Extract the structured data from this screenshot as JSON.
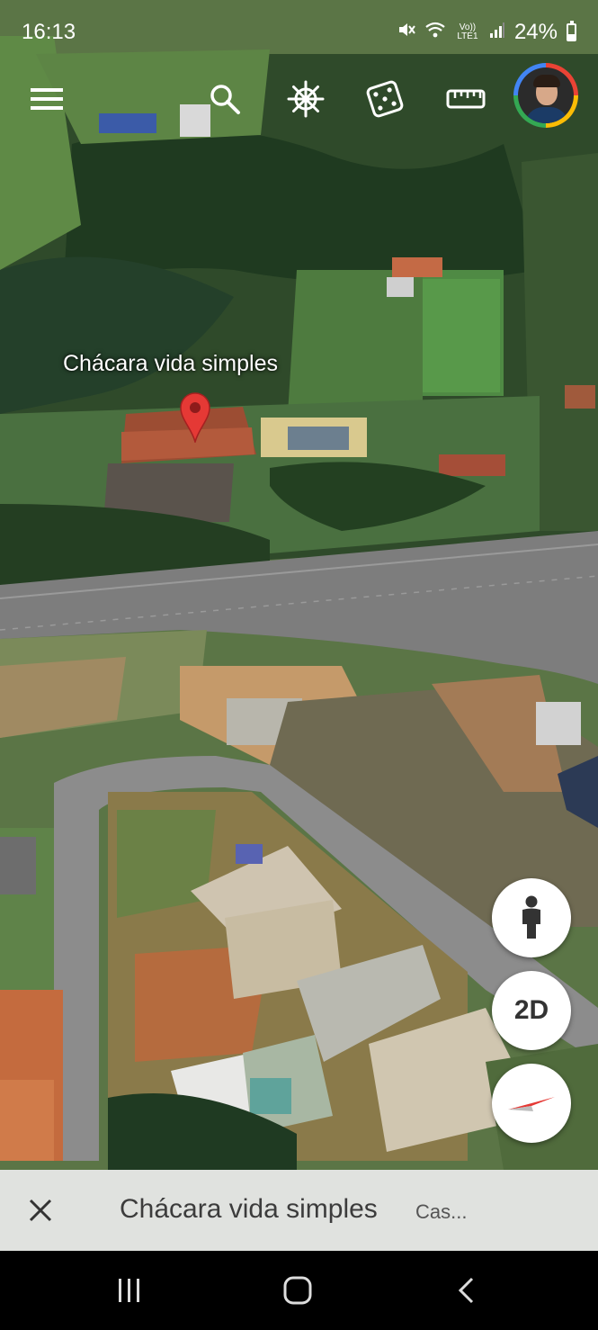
{
  "status_bar": {
    "time": "16:13",
    "volte": "Vo)) LTE1",
    "battery": "24%"
  },
  "toolbar": {
    "menu_icon": "menu-icon",
    "search_icon": "search-icon",
    "voyager_icon": "ships-wheel-icon",
    "random_icon": "dice-icon",
    "measure_icon": "ruler-icon",
    "account_icon": "avatar"
  },
  "map": {
    "place_label": "Chácara vida simples",
    "pin_color": "#e53935"
  },
  "fabs": {
    "street_view_icon": "pegman-icon",
    "view_mode": "2D",
    "compass_icon": "compass-icon"
  },
  "info_bar": {
    "title": "Chácara vida simples",
    "subtitle": "Cas..."
  },
  "nav_bar": {
    "recents_icon": "recents-icon",
    "home_icon": "home-icon",
    "back_icon": "back-icon"
  },
  "colors": {
    "avatar_ring": [
      "#ea4335",
      "#fbbc05",
      "#34a853",
      "#4285f4"
    ],
    "compass_red": "#e53935"
  }
}
